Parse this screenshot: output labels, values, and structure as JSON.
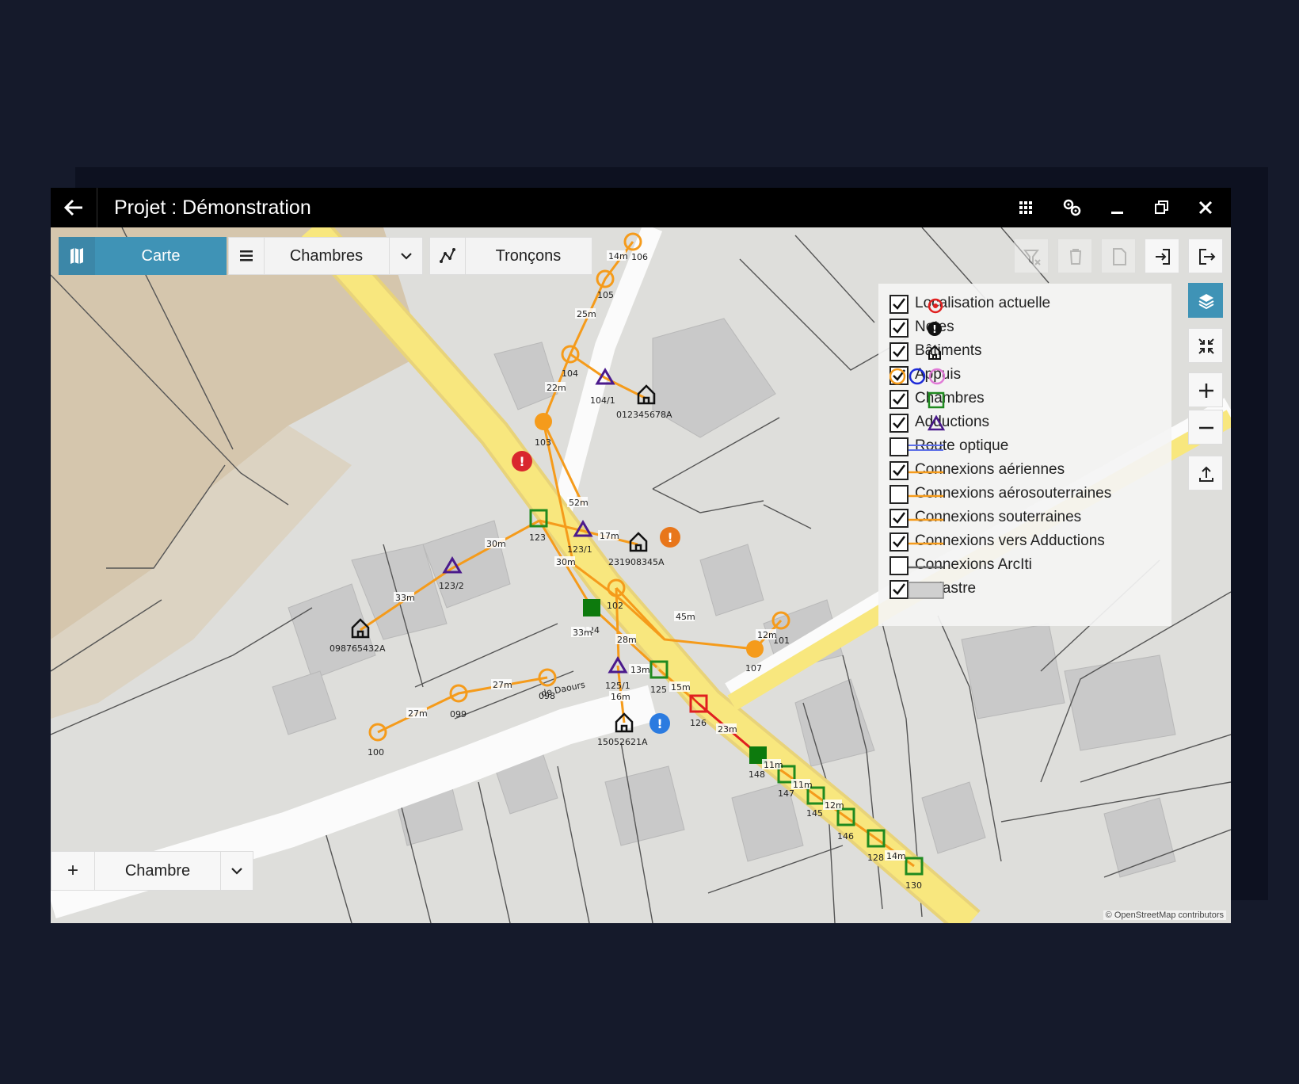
{
  "window": {
    "title": "Projet : Démonstration"
  },
  "toolbar": {
    "carte_label": "Carte",
    "chambres_label": "Chambres",
    "troncons_label": "Tronçons"
  },
  "legend": {
    "items": [
      {
        "label": "Localisation actuelle",
        "checked": true,
        "symbol": "target-icon"
      },
      {
        "label": "Notes",
        "checked": true,
        "symbol": "note-badge-icon"
      },
      {
        "label": "Bâtiments",
        "checked": true,
        "symbol": "house-icon"
      },
      {
        "label": "Appuis",
        "checked": true,
        "symbol": "circles-icon"
      },
      {
        "label": "Chambres",
        "checked": true,
        "symbol": "green-square-icon"
      },
      {
        "label": "Adductions",
        "checked": true,
        "symbol": "purple-triangle-icon"
      },
      {
        "label": "Route optique",
        "checked": false,
        "symbol": "blue-double-line"
      },
      {
        "label": "Connexions aériennes",
        "checked": true,
        "symbol": "orange-line"
      },
      {
        "label": "Connexions aérosouterraines",
        "checked": false,
        "symbol": "orange-line"
      },
      {
        "label": "Connexions souterraines",
        "checked": true,
        "symbol": "orange-line"
      },
      {
        "label": "Connexions vers Adductions",
        "checked": true,
        "symbol": "orange-line"
      },
      {
        "label": "Connexions ArcIti",
        "checked": false,
        "symbol": "gray-line"
      },
      {
        "label": "Cadastre",
        "checked": true,
        "symbol": "gray-rect"
      }
    ]
  },
  "bottom": {
    "add_label": "+",
    "type_label": "Chambre"
  },
  "map": {
    "street_name": "de Daours",
    "credit": "© OpenStreetMap contributors",
    "colors": {
      "appui": "#f59b1b",
      "chambre": "#1f8a1f",
      "adduction": "#4b1a8c",
      "connexion": "#f59b1b",
      "alert": "#d9272e"
    },
    "node_labels": {
      "n106": "106",
      "n105": "105",
      "n104": "104",
      "n104_1": "104/1",
      "b1": "012345678A",
      "n103": "103",
      "n123": "123",
      "n123_1": "123/1",
      "b2": "231908345A",
      "n123_2": "123/2",
      "b3": "098765432A",
      "n102": "102",
      "n124": "124",
      "n107": "107",
      "n101": "101",
      "n125_1": "125/1",
      "n125": "125",
      "n098": "098",
      "n099": "099",
      "n100": "100",
      "n126": "126",
      "b4": "15052621A",
      "n148": "148",
      "n147": "147",
      "n145": "145",
      "n146": "146",
      "n128": "128",
      "n130": "130"
    },
    "distances": {
      "d14": "14m",
      "d25": "25m",
      "d22": "22m",
      "d52": "52m",
      "d17": "17m",
      "d30a": "30m",
      "d30b": "30m",
      "d33a": "33m",
      "d33b": "33m",
      "d45": "45m",
      "d28": "28m",
      "d13": "13m",
      "d15": "15m",
      "d16": "16m",
      "d27a": "27m",
      "d27b": "27m",
      "d23": "23m",
      "d12a": "12m",
      "d11a": "11m",
      "d11b": "11m",
      "d12b": "12m",
      "d14b": "14m"
    }
  }
}
